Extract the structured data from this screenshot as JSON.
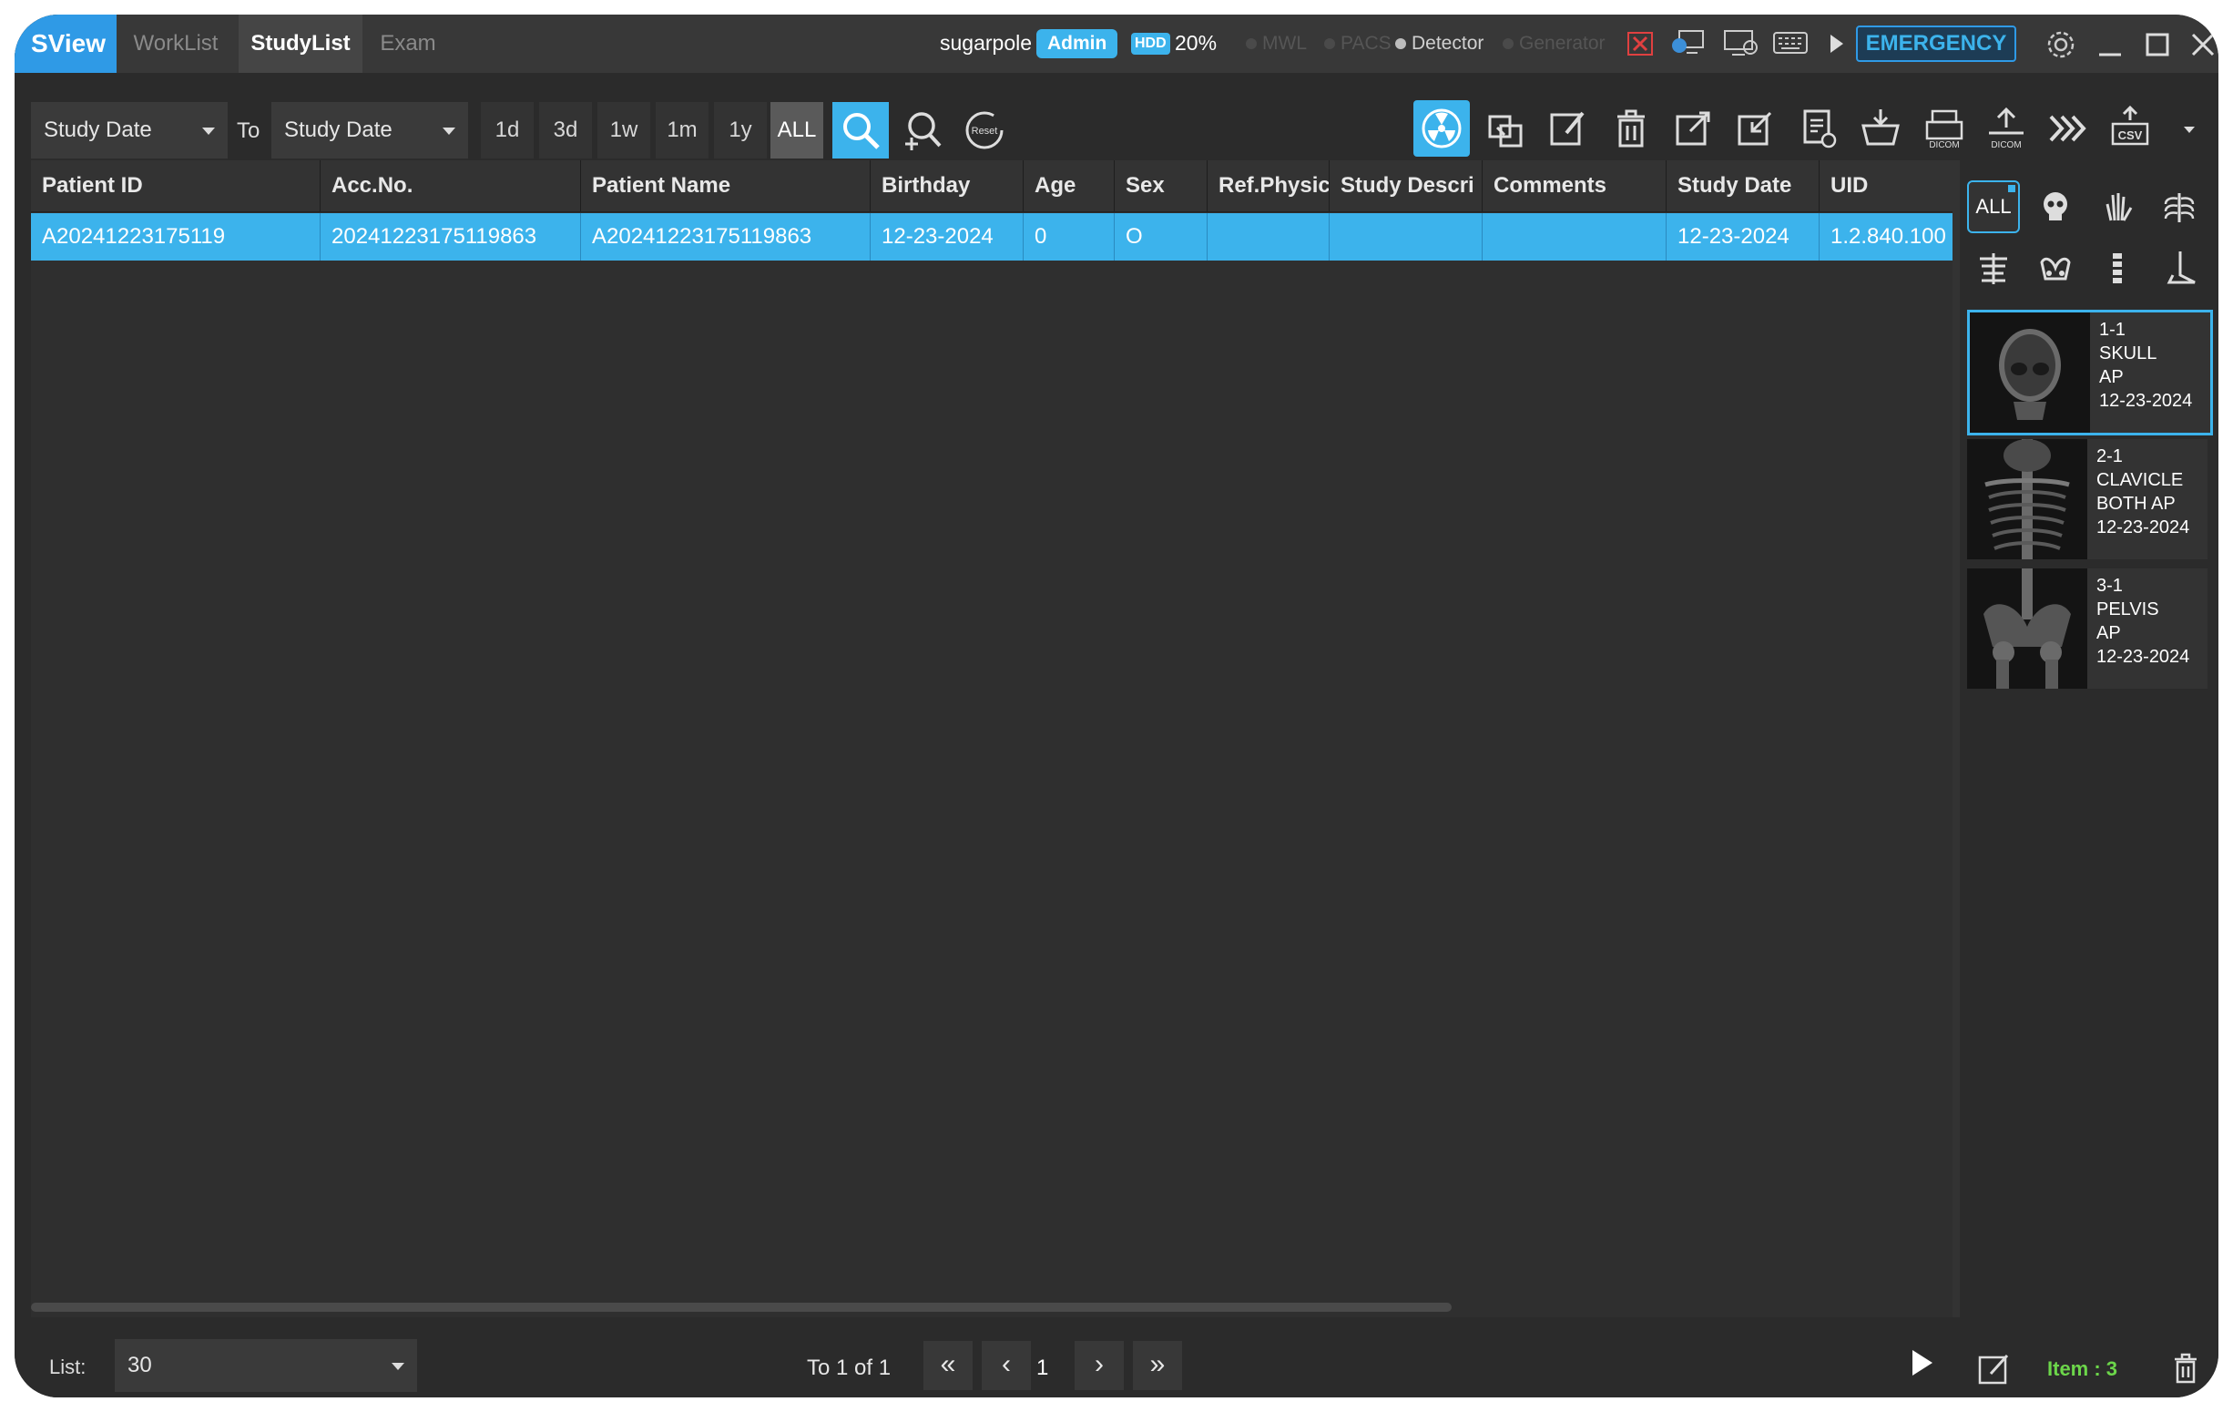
{
  "app": {
    "logo": "SView"
  },
  "tabs": [
    {
      "label": "WorkList",
      "active": false
    },
    {
      "label": "StudyList",
      "active": true
    },
    {
      "label": "Exam",
      "active": false
    }
  ],
  "status": {
    "user": "sugarpole",
    "role": "Admin",
    "hdd_label": "HDD",
    "hdd_value": "20%",
    "indicators": [
      "MWL",
      "PACS",
      "Detector",
      "Generator"
    ],
    "emergency": "EMERGENCY"
  },
  "filter": {
    "from_field": "Study Date",
    "to_label": "To",
    "to_field": "Study Date",
    "ranges": [
      "1d",
      "3d",
      "1w",
      "1m",
      "1y",
      "ALL"
    ],
    "active_range": "ALL",
    "reset_label": "Reset"
  },
  "toolbar_icons": [
    "radiation-icon",
    "merge-icon",
    "edit-icon",
    "trash-icon",
    "export-icon",
    "import-icon",
    "report-icon",
    "basket-icon",
    "dicom-print-icon",
    "dicom-send-icon",
    "fast-forward-icon",
    "csv-icon"
  ],
  "table": {
    "columns": [
      "Patient ID",
      "Acc.No.",
      "Patient Name",
      "Birthday",
      "Age",
      "Sex",
      "Ref.Physici",
      "Study Descri",
      "Comments",
      "Study Date",
      "UID"
    ],
    "rows": [
      [
        "A20241223175119",
        "20241223175119863",
        "A20241223175119863",
        "12-23-2024",
        "0",
        "O",
        "",
        "",
        "",
        "12-23-2024",
        "1.2.840.100"
      ]
    ]
  },
  "body_filter": {
    "all_label": "ALL"
  },
  "thumbnails": [
    {
      "index": "1-1",
      "line1": "SKULL",
      "line2": "AP",
      "date": "12-23-2024"
    },
    {
      "index": "2-1",
      "line1": "CLAVICLE",
      "line2": "BOTH AP",
      "date": "12-23-2024"
    },
    {
      "index": "3-1",
      "line1": "PELVIS",
      "line2": "AP",
      "date": "12-23-2024"
    }
  ],
  "footer": {
    "list_label": "List:",
    "list_value": "30",
    "page_text": "To 1 of 1",
    "page_number": "1",
    "item_count": "Item : 3"
  },
  "colors": {
    "accent": "#3cb3ec",
    "emergency": "#2f9ae6",
    "item_count": "#6cd64a"
  }
}
